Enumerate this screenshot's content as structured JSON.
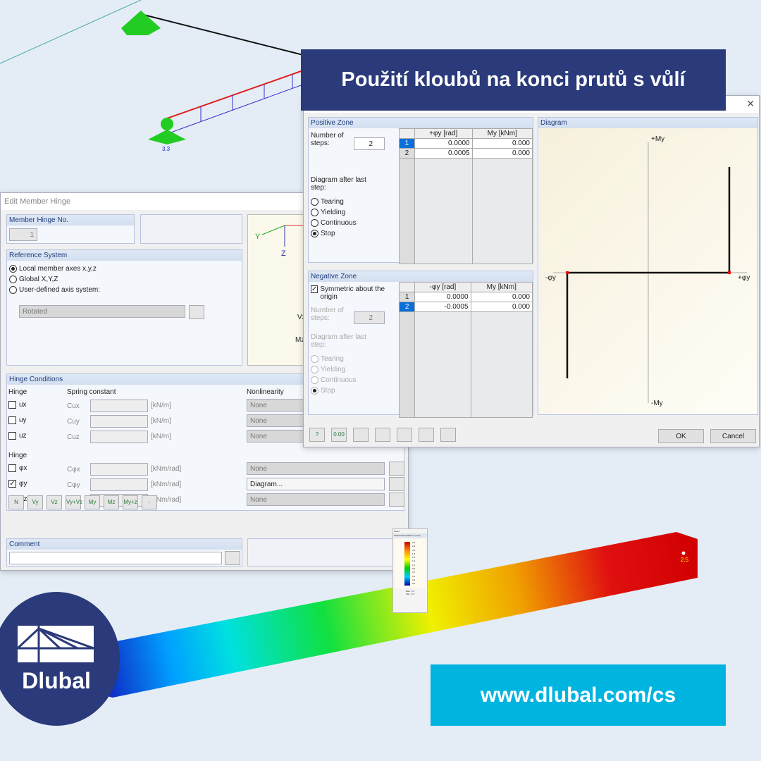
{
  "banner": {
    "title": "Použití kloubů na konci prutů s vůlí",
    "url": "www.dlubal.com/cs",
    "logo_text": "Dlubal"
  },
  "colors": {
    "navy": "#2a3a7a",
    "cyan": "#00b4e0",
    "arrow": "#e04848"
  },
  "model": {
    "support_label": "3.3",
    "beam_max_label": "2.5"
  },
  "nonlinear_dialog": {
    "positive_zone": {
      "title": "Positive Zone",
      "steps_label": "Number of steps:",
      "steps": "2",
      "after_label": "Diagram after last step:",
      "options": [
        "Tearing",
        "Yielding",
        "Continuous",
        "Stop"
      ],
      "selected": "Stop",
      "headers": [
        "",
        "+φy [rad]",
        "My [kNm]"
      ],
      "rows": [
        [
          "1",
          "0.0000",
          "0.000"
        ],
        [
          "2",
          "0.0005",
          "0.000"
        ]
      ]
    },
    "negative_zone": {
      "title": "Negative Zone",
      "symmetric_label": "Symmetric about the origin",
      "symmetric": true,
      "steps_label": "Number of steps:",
      "steps": "2",
      "after_label": "Diagram after last step:",
      "options": [
        "Tearing",
        "Yielding",
        "Continuous",
        "Stop"
      ],
      "headers": [
        "",
        "-φy [rad]",
        "My [kNm]"
      ],
      "rows": [
        [
          "1",
          "0.0000",
          "0.000"
        ],
        [
          "2",
          "-0.0005",
          "0.000"
        ]
      ]
    },
    "diagram": {
      "title": "Diagram",
      "y_pos": "+My",
      "y_neg": "-My",
      "x_pos": "+φy",
      "x_neg": "-φy"
    },
    "ok": "OK",
    "cancel": "Cancel"
  },
  "hinge_dialog": {
    "title": "Edit Member Hinge",
    "hinge_no_label": "Member Hinge No.",
    "hinge_no": "1",
    "ref_title": "Reference System",
    "ref_options": [
      "Local member axes x,y,z",
      "Global X,Y,Z",
      "User-defined axis system:"
    ],
    "ref_selected": 0,
    "ref_combo": "Rotated",
    "axes": {
      "y": "Y",
      "z": "Z",
      "vz": "Vz",
      "mz": "Mz"
    },
    "cond_title": "Hinge Conditions",
    "hinge_label": "Hinge",
    "spring_label": "Spring constant",
    "nonlinear_label": "Nonlinearity",
    "trans": [
      {
        "name": "ux",
        "c": "Cux",
        "unit": "[kN/m]",
        "nl": "None",
        "checked": false
      },
      {
        "name": "uy",
        "c": "Cuy",
        "unit": "[kN/m]",
        "nl": "None",
        "checked": false
      },
      {
        "name": "uz",
        "c": "Cuz",
        "unit": "[kN/m]",
        "nl": "None",
        "checked": false
      }
    ],
    "rot": [
      {
        "name": "φx",
        "c": "Cφx",
        "unit": "[kNm/rad]",
        "nl": "None",
        "checked": false
      },
      {
        "name": "φy",
        "c": "Cφy",
        "unit": "[kNm/rad]",
        "nl": "Diagram...",
        "checked": true
      },
      {
        "name": "φz",
        "c": "Cφz",
        "unit": "[kNm/rad]",
        "nl": "None",
        "checked": false
      }
    ],
    "tool_buttons": [
      "N",
      "Vy",
      "Vz",
      "Vy+Vz",
      "My",
      "Mz",
      "My+z",
      "-"
    ],
    "comment_label": "Comment"
  },
  "panel": {
    "title": "Panel",
    "subtitle": "Global Deformations u [mm]",
    "scale": [
      "2.5",
      "2.2",
      "2.0",
      "1.8",
      "1.6",
      "1.3",
      "1.1",
      "0.9",
      "0.7",
      "0.4",
      "0.2",
      "0.0"
    ],
    "max": "Max : 2.5",
    "min": "Min : 0.0"
  }
}
